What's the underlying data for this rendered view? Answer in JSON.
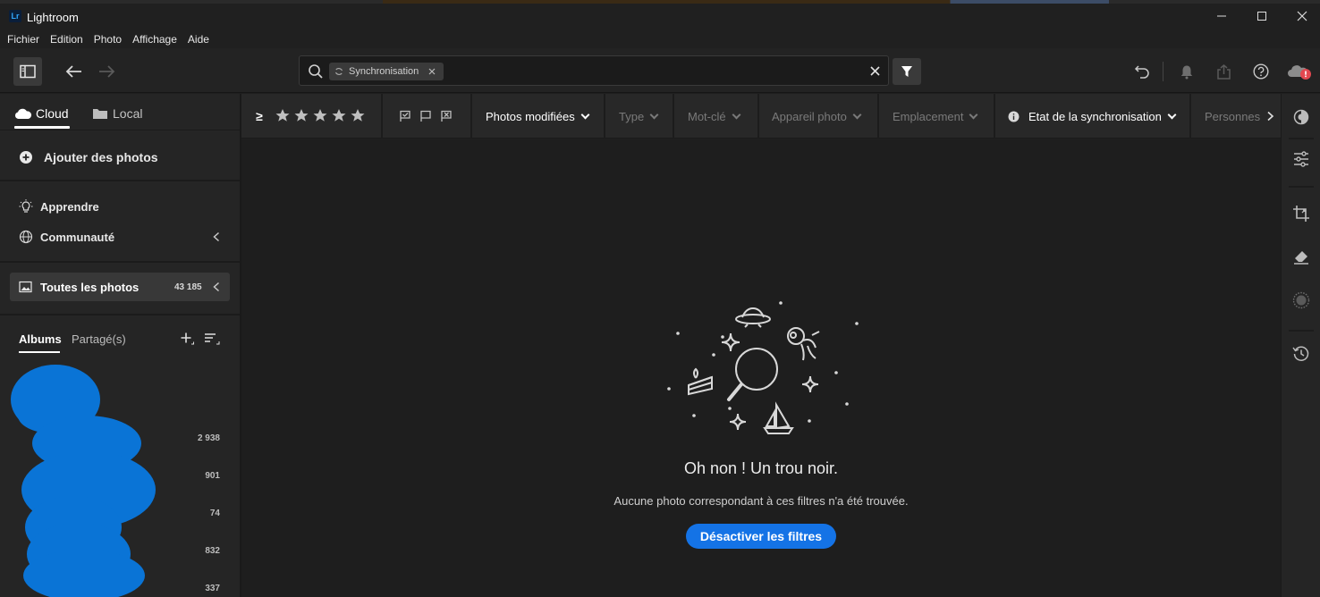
{
  "window": {
    "app_name": "Lightroom",
    "logo_text": "Lr"
  },
  "menu": [
    "Fichier",
    "Edition",
    "Photo",
    "Affichage",
    "Aide"
  ],
  "search": {
    "chip_label": "Synchronisation"
  },
  "left_panel": {
    "tabs": {
      "cloud": "Cloud",
      "local": "Local"
    },
    "add_photos": "Ajouter des photos",
    "learn": "Apprendre",
    "community": "Communauté",
    "all_photos": {
      "label": "Toutes les photos",
      "count": "43 185"
    },
    "album_tabs": {
      "albums": "Albums",
      "shared": "Partagé(s)"
    },
    "album_counts": [
      "2 938",
      "901",
      "74",
      "832",
      "337"
    ]
  },
  "filter_bar": {
    "rating_op": "≥",
    "filters": [
      {
        "label": "Photos modifiées",
        "active": true
      },
      {
        "label": "Type",
        "active": false
      },
      {
        "label": "Mot-clé",
        "active": false
      },
      {
        "label": "Appareil photo",
        "active": false
      },
      {
        "label": "Emplacement",
        "active": false
      },
      {
        "label": "Etat de la synchronisation",
        "active": true
      },
      {
        "label": "Personnes",
        "active": false
      }
    ]
  },
  "empty_state": {
    "title": "Oh non ! Un trou noir.",
    "message": "Aucune photo correspondant à ces filtres n'a été trouvée.",
    "button": "Désactiver les filtres"
  },
  "colors": {
    "accent": "#1473e6",
    "alert": "#e34850",
    "redaction": "#0a74d6"
  }
}
